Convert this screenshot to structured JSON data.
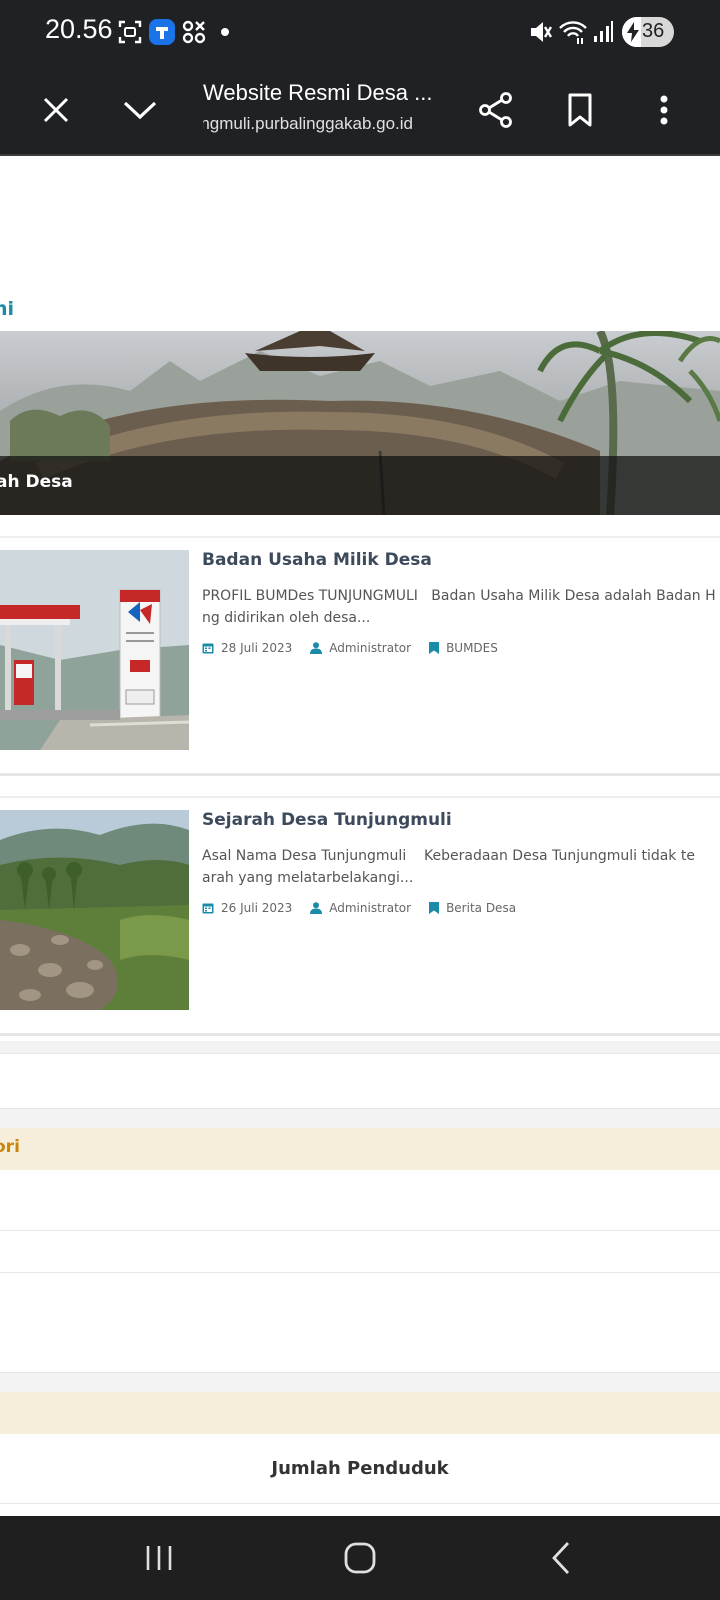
{
  "status_bar": {
    "time": "20.56",
    "battery": "36",
    "battery_level": 0.36,
    "icons": [
      "screenshot-icon",
      "app-notification-icon",
      "grid-app-icon",
      "mute-icon",
      "wifi-icon",
      "signal-icon",
      "charging-icon"
    ]
  },
  "toolbar": {
    "title": "Website Resmi Desa ...",
    "url": "tunjungmuli.purbalinggakab.go.id",
    "icons": [
      "close-icon",
      "chevron-down-icon",
      "share-icon",
      "bookmark-icon",
      "more-vert-icon"
    ]
  },
  "content": {
    "section_heading": "ni",
    "hero_caption": "ah Desa",
    "articles": [
      {
        "title": "Badan Usaha Milik Desa",
        "excerpt_line1": "PROFIL BUMDes TUNJUNGMULI   Badan Usaha Milik Desa adalah Badan H",
        "excerpt_line2": "ng didirikan oleh desa...",
        "date": "28 Juli 2023",
        "author": "Administrator",
        "category": "BUMDES"
      },
      {
        "title": "Sejarah Desa Tunjungmuli",
        "excerpt_line1": "Asal Nama Desa Tunjungmuli    Keberadaan Desa Tunjungmuli tidak te",
        "excerpt_line2": "arah yang melatarbelakangi...",
        "date": "26 Juli 2023",
        "author": "Administrator",
        "category": "Berita Desa"
      }
    ],
    "kategori_heading": "ori",
    "jumlah_penduduk": "Jumlah Penduduk"
  },
  "colors": {
    "accent_teal": "#1a8ca8",
    "accent_orange": "#c8870c",
    "beige": "#f6eedb",
    "chrome": "#202124"
  },
  "nav_bar": {
    "icons": [
      "recent-apps-icon",
      "home-icon",
      "back-icon"
    ]
  }
}
